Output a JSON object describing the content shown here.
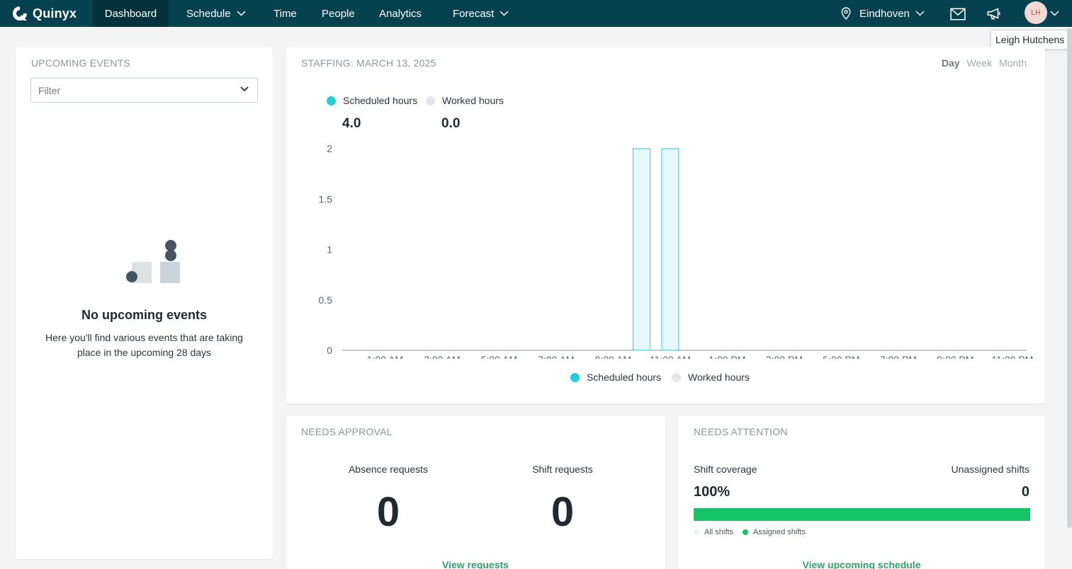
{
  "nav": {
    "brand": "Quinyx",
    "items": [
      {
        "label": "Dashboard",
        "active": true
      },
      {
        "label": "Schedule",
        "dropdown": true
      },
      {
        "label": "Time"
      },
      {
        "label": "People"
      },
      {
        "label": "Analytics"
      },
      {
        "label": "Forecast",
        "dropdown": true
      }
    ],
    "location": "Eindhoven",
    "user_initials": "LH",
    "tooltip": "Leigh Hutchens",
    "icons": [
      "location-pin-icon",
      "mail-icon",
      "megaphone-icon",
      "chevron-down-icon"
    ]
  },
  "upcoming_events": {
    "title": "UPCOMING EVENTS",
    "filter_placeholder": "Filter",
    "empty_title": "No upcoming events",
    "empty_desc": "Here you'll find various events that are taking place in the upcoming 28 days"
  },
  "staffing": {
    "title": "STAFFING: MARCH 13, 2025",
    "views": [
      "Day",
      "Week",
      "Month"
    ],
    "active_view": "Day",
    "scheduled_label": "Scheduled hours",
    "worked_label": "Worked hours",
    "scheduled_value": "4.0",
    "worked_value": "0.0",
    "colors": {
      "scheduled": "#1fd0d8",
      "worked": "#e5e5ee"
    }
  },
  "chart_data": {
    "type": "bar",
    "categories": [
      "12:00 AM",
      "1:00 AM",
      "2:00 AM",
      "3:00 AM",
      "4:00 AM",
      "5:00 AM",
      "6:00 AM",
      "7:00 AM",
      "8:00 AM",
      "9:00 AM",
      "10:00 AM",
      "11:00 AM",
      "12:00 PM",
      "1:00 PM",
      "2:00 PM",
      "3:00 PM",
      "4:00 PM",
      "5:00 PM",
      "6:00 PM",
      "7:00 PM",
      "8:00 PM",
      "9:00 PM",
      "10:00 PM",
      "11:00 PM"
    ],
    "x_tick_labels": [
      "1:00 AM",
      "3:00 AM",
      "5:00 AM",
      "7:00 AM",
      "9:00 AM",
      "11:00 AM",
      "1:00 PM",
      "3:00 PM",
      "5:00 PM",
      "7:00 PM",
      "9:00 PM",
      "11:00 PM"
    ],
    "y_tick_labels": [
      "0",
      "0.5",
      "1",
      "1.5",
      "2"
    ],
    "ylim": [
      0,
      2
    ],
    "series": [
      {
        "name": "Scheduled hours",
        "values": [
          0,
          0,
          0,
          0,
          0,
          0,
          0,
          0,
          0,
          0,
          2,
          2,
          0,
          0,
          0,
          0,
          0,
          0,
          0,
          0,
          0,
          0,
          0,
          0
        ]
      },
      {
        "name": "Worked hours",
        "values": [
          0,
          0,
          0,
          0,
          0,
          0,
          0,
          0,
          0,
          0,
          0,
          0,
          0,
          0,
          0,
          0,
          0,
          0,
          0,
          0,
          0,
          0,
          0,
          0
        ]
      }
    ],
    "legend": "bottom",
    "grid": false
  },
  "needs_approval": {
    "title": "NEEDS APPROVAL",
    "absence_label": "Absence requests",
    "absence_value": "0",
    "shift_label": "Shift requests",
    "shift_value": "0",
    "link": "View requests"
  },
  "needs_attention": {
    "title": "NEEDS ATTENTION",
    "coverage_label": "Shift coverage",
    "coverage_value": "100%",
    "coverage_fraction": 1.0,
    "unassigned_label": "Unassigned shifts",
    "unassigned_value": "0",
    "legend_all": "All shifts",
    "legend_assigned": "Assigned shifts",
    "link": "View upcoming schedule",
    "colors": {
      "assigned": "#16c466",
      "all": "#e6f4ee"
    }
  }
}
